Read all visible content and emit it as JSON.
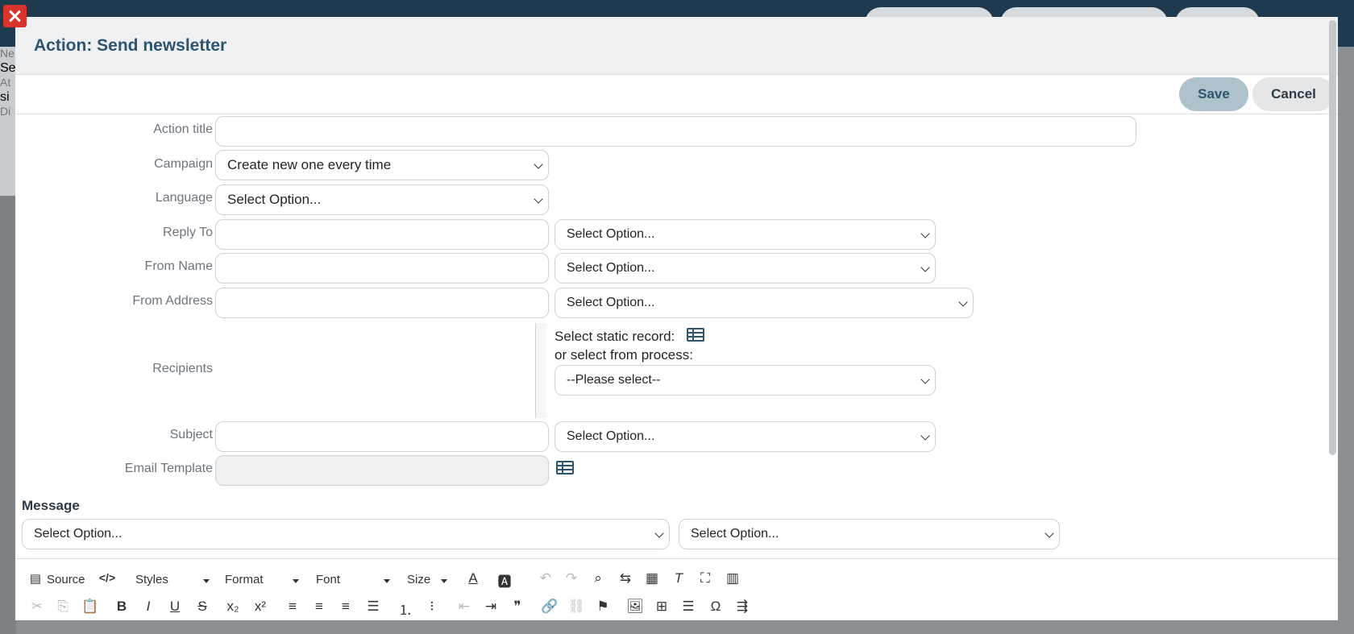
{
  "modal": {
    "title": "Action: Send newsletter",
    "save_label": "Save",
    "cancel_label": "Cancel"
  },
  "form": {
    "action_title": {
      "label": "Action title",
      "value": ""
    },
    "campaign": {
      "label": "Campaign",
      "value": "Create new one every time"
    },
    "language": {
      "label": "Language",
      "value": "Select Option..."
    },
    "reply_to": {
      "label": "Reply To",
      "value": "",
      "option": "Select Option..."
    },
    "from_name": {
      "label": "From Name",
      "value": "",
      "option": "Select Option..."
    },
    "from_address": {
      "label": "From Address",
      "value": "",
      "option": "Select Option..."
    },
    "recipients": {
      "label": "Recipients",
      "static_text": "Select static record:",
      "process_text": "or select from process:",
      "process_value": "--Please select--"
    },
    "subject": {
      "label": "Subject",
      "value": "",
      "option": "Select Option..."
    },
    "email_template": {
      "label": "Email Template",
      "value": ""
    }
  },
  "message": {
    "title": "Message",
    "select_1": "Select Option...",
    "select_2": "Select Option..."
  },
  "editor": {
    "source_label": "Source",
    "styles_label": "Styles",
    "format_label": "Format",
    "font_label": "Font",
    "size_label": "Size"
  },
  "background": {
    "left_letters": [
      "Ne",
      "Se",
      "At",
      "si",
      "Di"
    ]
  }
}
